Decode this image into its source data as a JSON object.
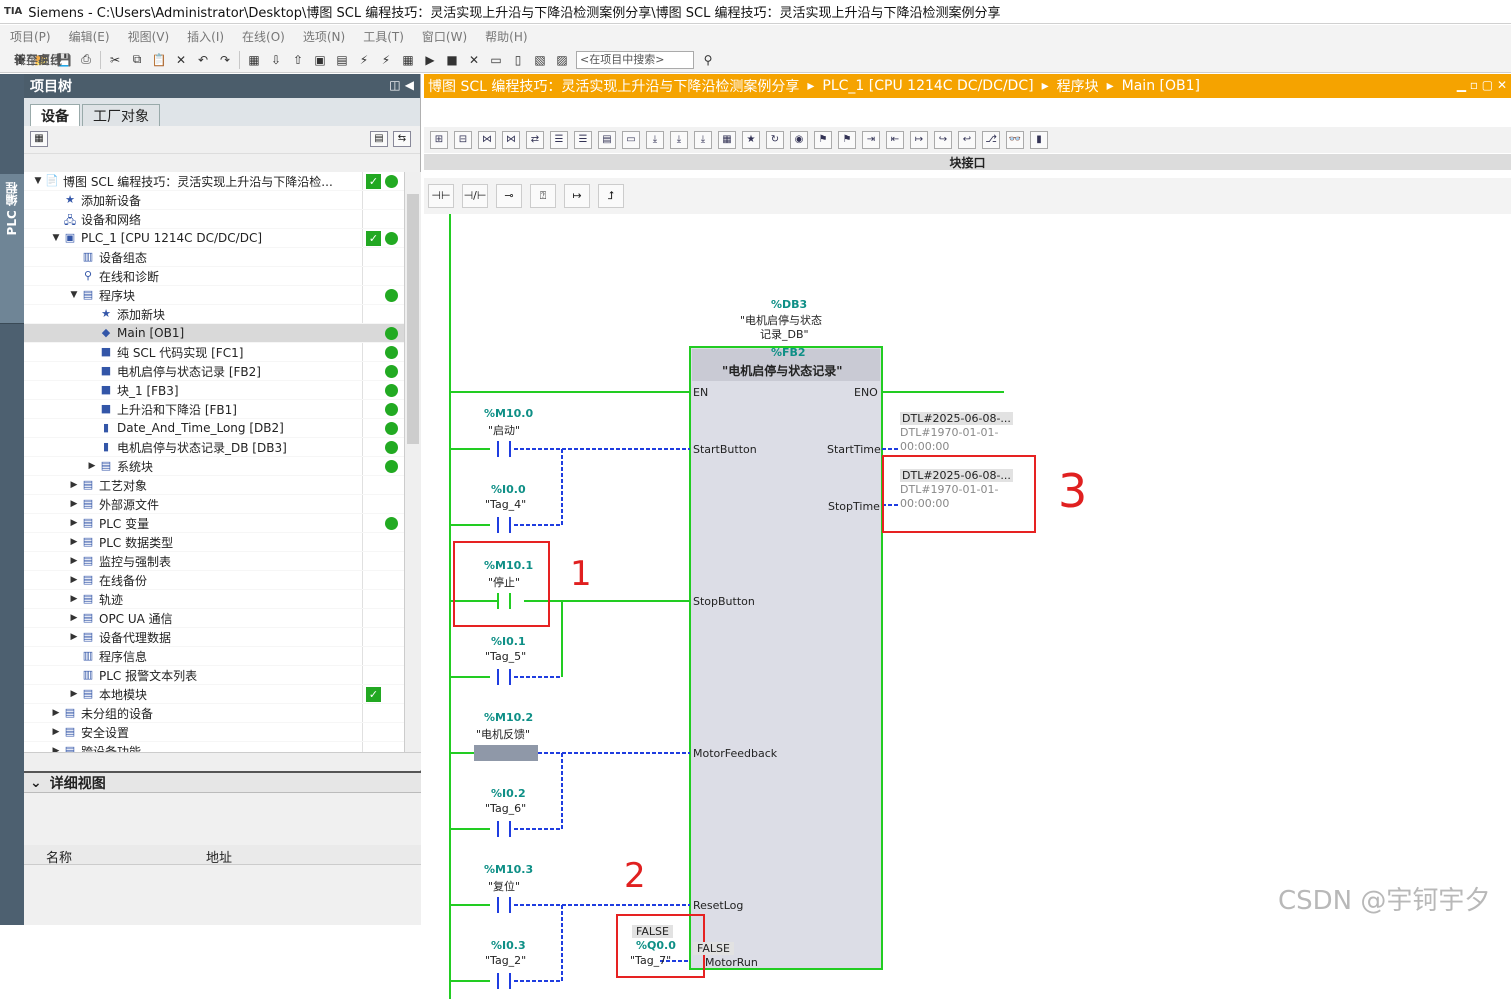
{
  "window": {
    "title": "Siemens - C:\\Users\\Administrator\\Desktop\\博图 SCL 编程技巧：灵活实现上升沿与下降沿检测案例分享\\博图 SCL 编程技巧：灵活实现上升沿与下降沿检测案例分享",
    "logo": "TIA"
  },
  "menu": [
    "项目(P)",
    "编辑(E)",
    "视图(V)",
    "插入(I)",
    "在线(O)",
    "选项(N)",
    "工具(T)",
    "窗口(W)",
    "帮助(H)"
  ],
  "toolbar": {
    "save_label": "保存项目",
    "go_online": "转至在线",
    "go_offline": "转至离线",
    "search_placeholder": "<在项目中搜索>"
  },
  "side_tab": "PLC 编程",
  "project_tree": {
    "title": "项目树",
    "tabs": [
      "设备",
      "工厂对象"
    ],
    "items": [
      {
        "label": "博图 SCL 编程技巧：灵活实现上升沿与下降沿检...",
        "indent": 0,
        "tri": "▼",
        "icon": "📄",
        "s1": true,
        "s2": true
      },
      {
        "label": "添加新设备",
        "indent": 1,
        "tri": "",
        "icon": "★",
        "s1": false,
        "s2": false
      },
      {
        "label": "设备和网络",
        "indent": 1,
        "tri": "",
        "icon": "🖧",
        "s1": false,
        "s2": false
      },
      {
        "label": "PLC_1 [CPU 1214C DC/DC/DC]",
        "indent": 1,
        "tri": "▼",
        "icon": "▣",
        "s1": true,
        "s2": true
      },
      {
        "label": "设备组态",
        "indent": 2,
        "tri": "",
        "icon": "▥",
        "s1": false,
        "s2": false
      },
      {
        "label": "在线和诊断",
        "indent": 2,
        "tri": "",
        "icon": "⚲",
        "s1": false,
        "s2": false
      },
      {
        "label": "程序块",
        "indent": 2,
        "tri": "▼",
        "icon": "▤",
        "s1": false,
        "s2": true
      },
      {
        "label": "添加新块",
        "indent": 3,
        "tri": "",
        "icon": "★",
        "s1": false,
        "s2": false
      },
      {
        "label": "Main [OB1]",
        "indent": 3,
        "tri": "",
        "icon": "◆",
        "s1": false,
        "s2": true,
        "sel": true
      },
      {
        "label": "纯 SCL 代码实现 [FC1]",
        "indent": 3,
        "tri": "",
        "icon": "■",
        "s1": false,
        "s2": true
      },
      {
        "label": "电机启停与状态记录 [FB2]",
        "indent": 3,
        "tri": "",
        "icon": "■",
        "s1": false,
        "s2": true
      },
      {
        "label": "块_1 [FB3]",
        "indent": 3,
        "tri": "",
        "icon": "■",
        "s1": false,
        "s2": true
      },
      {
        "label": "上升沿和下降沿 [FB1]",
        "indent": 3,
        "tri": "",
        "icon": "■",
        "s1": false,
        "s2": true
      },
      {
        "label": "Date_And_Time_Long [DB2]",
        "indent": 3,
        "tri": "",
        "icon": "▮",
        "s1": false,
        "s2": true
      },
      {
        "label": "电机启停与状态记录_DB [DB3]",
        "indent": 3,
        "tri": "",
        "icon": "▮",
        "s1": false,
        "s2": true
      },
      {
        "label": "系统块",
        "indent": 3,
        "tri": "▶",
        "icon": "▤",
        "s1": false,
        "s2": true
      },
      {
        "label": "工艺对象",
        "indent": 2,
        "tri": "▶",
        "icon": "▤",
        "s1": false,
        "s2": false
      },
      {
        "label": "外部源文件",
        "indent": 2,
        "tri": "▶",
        "icon": "▤",
        "s1": false,
        "s2": false
      },
      {
        "label": "PLC 变量",
        "indent": 2,
        "tri": "▶",
        "icon": "▤",
        "s1": false,
        "s2": true
      },
      {
        "label": "PLC 数据类型",
        "indent": 2,
        "tri": "▶",
        "icon": "▤",
        "s1": false,
        "s2": false
      },
      {
        "label": "监控与强制表",
        "indent": 2,
        "tri": "▶",
        "icon": "▤",
        "s1": false,
        "s2": false
      },
      {
        "label": "在线备份",
        "indent": 2,
        "tri": "▶",
        "icon": "▤",
        "s1": false,
        "s2": false
      },
      {
        "label": "轨迹",
        "indent": 2,
        "tri": "▶",
        "icon": "▤",
        "s1": false,
        "s2": false
      },
      {
        "label": "OPC UA 通信",
        "indent": 2,
        "tri": "▶",
        "icon": "▤",
        "s1": false,
        "s2": false
      },
      {
        "label": "设备代理数据",
        "indent": 2,
        "tri": "▶",
        "icon": "▤",
        "s1": false,
        "s2": false
      },
      {
        "label": "程序信息",
        "indent": 2,
        "tri": "",
        "icon": "▥",
        "s1": false,
        "s2": false
      },
      {
        "label": "PLC 报警文本列表",
        "indent": 2,
        "tri": "",
        "icon": "▥",
        "s1": false,
        "s2": false
      },
      {
        "label": "本地模块",
        "indent": 2,
        "tri": "▶",
        "icon": "▤",
        "s1": true,
        "s2": false
      },
      {
        "label": "未分组的设备",
        "indent": 1,
        "tri": "▶",
        "icon": "▤",
        "s1": false,
        "s2": false
      },
      {
        "label": "安全设置",
        "indent": 1,
        "tri": "▶",
        "icon": "▤",
        "s1": false,
        "s2": false
      },
      {
        "label": "跨设备功能",
        "indent": 1,
        "tri": "▶",
        "icon": "▤",
        "s1": false,
        "s2": false
      }
    ]
  },
  "detail_view": {
    "title": "详细视图",
    "col_name": "名称",
    "col_address": "地址"
  },
  "editor": {
    "breadcrumb": [
      "博图 SCL 编程技巧：灵活实现上升沿与下降沿检测案例分享",
      "PLC_1 [CPU 1214C DC/DC/DC]",
      "程序块",
      "Main [OB1]"
    ],
    "block_interface": "块接口",
    "instance": {
      "addr": "%DB3",
      "name1": "\"电机启停与状态",
      "name2": "记录_DB\""
    },
    "fb": {
      "addr": "%FB2",
      "name": "\"电机启停与状态记录\""
    },
    "pins": {
      "en": "EN",
      "eno": "ENO",
      "start": "StartButton",
      "stop": "StopButton",
      "feedback": "MotorFeedback",
      "reset": "ResetLog",
      "run": "MotorRun",
      "starttime": "StartTime",
      "stoptime": "StopTime"
    },
    "contacts": [
      {
        "addr": "%M10.0",
        "name": "\"启动\""
      },
      {
        "addr": "%I0.0",
        "name": "\"Tag_4\""
      },
      {
        "addr": "%M10.1",
        "name": "\"停止\""
      },
      {
        "addr": "%I0.1",
        "name": "\"Tag_5\""
      },
      {
        "addr": "%M10.2",
        "name": "\"电机反馈\""
      },
      {
        "addr": "%I0.2",
        "name": "\"Tag_6\""
      },
      {
        "addr": "%M10.3",
        "name": "\"复位\""
      },
      {
        "addr": "%I0.3",
        "name": "\"Tag_2\""
      }
    ],
    "outputs": {
      "start_val": "DTL#2025-06-08-...",
      "start_old1": "DTL#1970-01-01-",
      "start_old2": "00:00:00",
      "stop_val": "DTL#2025-06-08-...",
      "stop_old1": "DTL#1970-01-01-",
      "stop_old2": "00:00:00",
      "run_false": "FALSE",
      "run_addr": "%Q0.0",
      "run_name": "\"Tag_7\"",
      "run_pin_false": "FALSE"
    },
    "annotations": [
      "1",
      "2",
      "3"
    ]
  },
  "watermark": "CSDN @宇钶宇夕"
}
